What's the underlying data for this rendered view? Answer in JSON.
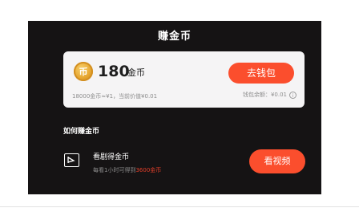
{
  "header": {
    "title": "赚金币"
  },
  "wallet": {
    "coin_icon_char": "币",
    "coin_amount": "180",
    "coin_unit": "金币",
    "button_label": "去钱包",
    "rate_text": "18000金币≈¥1，当前价值¥0.01",
    "balance_text": "钱包余额：¥0.01",
    "info_char": "i"
  },
  "section": {
    "title": "如何赚金币"
  },
  "task": {
    "title": "看剧得金币",
    "desc_prefix": "每看1小时可得到",
    "desc_highlight": "3600金币",
    "button_label": "看视频",
    "highlight_color": "#e33f2a"
  },
  "colors": {
    "accent": "#fb4e2d",
    "background": "#151314",
    "card": "#f5f4f5"
  },
  "icons": [
    "coin-icon",
    "info-icon",
    "play-video-icon"
  ]
}
